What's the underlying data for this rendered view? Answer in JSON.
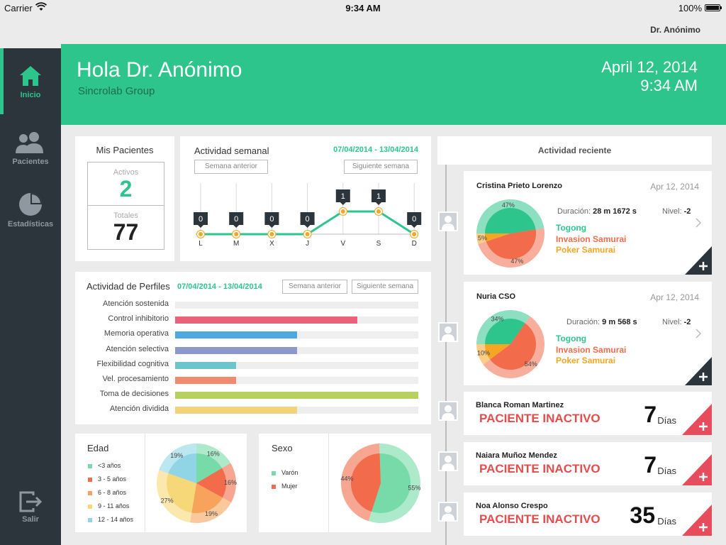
{
  "status": {
    "carrier": "Carrier",
    "time": "9:34 AM",
    "battery": "100%"
  },
  "user": "Dr. Anónimo",
  "sidebar": {
    "items": [
      {
        "label": "Inicio",
        "icon": "home-icon"
      },
      {
        "label": "Pacientes",
        "icon": "users-icon"
      },
      {
        "label": "Estadísticas",
        "icon": "pie-chart-icon"
      }
    ],
    "logout": "Salir"
  },
  "header": {
    "greeting": "Hola Dr. Anónimo",
    "org": "Sincrolab Group",
    "date": "April 12, 2014",
    "time": "9:34 AM"
  },
  "patients": {
    "title": "Mis Pacientes",
    "active_label": "Activos",
    "active": "2",
    "total_label": "Totales",
    "total": "77"
  },
  "weekly": {
    "title": "Actividad semanal",
    "range": "07/04/2014 - 13/04/2014",
    "prev": "Semana anterior",
    "next": "Siguiente semana"
  },
  "profiles": {
    "title": "Actividad de Perfiles",
    "range": "07/04/2014 - 13/04/2014",
    "prev": "Semana anterior",
    "next": "Siguiente semana",
    "bars": [
      {
        "label": "Atención sostenida",
        "value": 0,
        "color": "#eeeeee"
      },
      {
        "label": "Control inhibitorio",
        "value": 0.75,
        "color": "#e8627a"
      },
      {
        "label": "Memoria operativa",
        "value": 0.5,
        "color": "#4ba8e0"
      },
      {
        "label": "Atención selectiva",
        "value": 0.5,
        "color": "#8d97c9"
      },
      {
        "label": "Flexibilidad cognitiva",
        "value": 0.25,
        "color": "#6cc4cc"
      },
      {
        "label": "Vel. procesamiento",
        "value": 0.25,
        "color": "#f08a6c"
      },
      {
        "label": "Toma de decisiones",
        "value": 1.0,
        "color": "#b8d060"
      },
      {
        "label": "Atención dividida",
        "value": 0.5,
        "color": "#f5d27a"
      }
    ]
  },
  "chart_data": [
    {
      "type": "line",
      "title": "Actividad semanal",
      "categories": [
        "L",
        "M",
        "X",
        "J",
        "V",
        "S",
        "D"
      ],
      "values": [
        0,
        0,
        0,
        0,
        1,
        1,
        0
      ],
      "color": "#2ec58d"
    },
    {
      "type": "pie",
      "title": "Edad",
      "categories": [
        "<3 años",
        "3 - 5 años",
        "6 - 8 años",
        "9 - 11 años",
        "12 - 14 años"
      ],
      "values": [
        16,
        16,
        19,
        27,
        19
      ],
      "labels": [
        "16%",
        "16%",
        "19%",
        "27%",
        "19%"
      ],
      "colors": [
        "#76dba8",
        "#f26b4a",
        "#f7a35c",
        "#f7d879",
        "#90d5e6"
      ]
    },
    {
      "type": "pie",
      "title": "Sexo",
      "categories": [
        "Varón",
        "Mujer"
      ],
      "values": [
        55,
        44
      ],
      "labels": [
        "55%",
        "44%"
      ],
      "colors": [
        "#76dba8",
        "#f26b4a"
      ]
    }
  ],
  "recent": {
    "title": "Actividad reciente",
    "duration_label": "Duración:",
    "level_label": "Nivel:",
    "detailed": [
      {
        "name": "Cristina Prieto Lorenzo",
        "date": "Apr 12, 2014",
        "duration": "28 m 1672 s",
        "level": "-2",
        "games": [
          "Togong",
          "Invasion Samurai",
          "Poker Samurai"
        ],
        "pie": {
          "values": [
            47,
            47,
            5
          ],
          "labels": [
            "47%",
            "47%",
            "5%"
          ]
        }
      },
      {
        "name": "Nuria  CSO",
        "date": "Apr 12, 2014",
        "duration": "9 m 568 s",
        "level": "-2",
        "games": [
          "Togong",
          "Invasion Samurai",
          "Poker Samurai"
        ],
        "pie": {
          "values": [
            34,
            54,
            10
          ],
          "labels": [
            "34%",
            "54%",
            "10%"
          ]
        }
      }
    ],
    "inactive": [
      {
        "name": "Blanca Roman Martinez",
        "status": "PACIENTE INACTIVO",
        "days": "7",
        "days_label": "Días"
      },
      {
        "name": "Naiara Muñoz Mendez",
        "status": "PACIENTE INACTIVO",
        "days": "7",
        "days_label": "Días"
      },
      {
        "name": "Noa Alonso Crespo",
        "status": "PACIENTE INACTIVO",
        "days": "35",
        "days_label": "Días"
      }
    ],
    "game_colors": [
      "#2ec58d",
      "#f26b4a",
      "#f5a623"
    ]
  }
}
